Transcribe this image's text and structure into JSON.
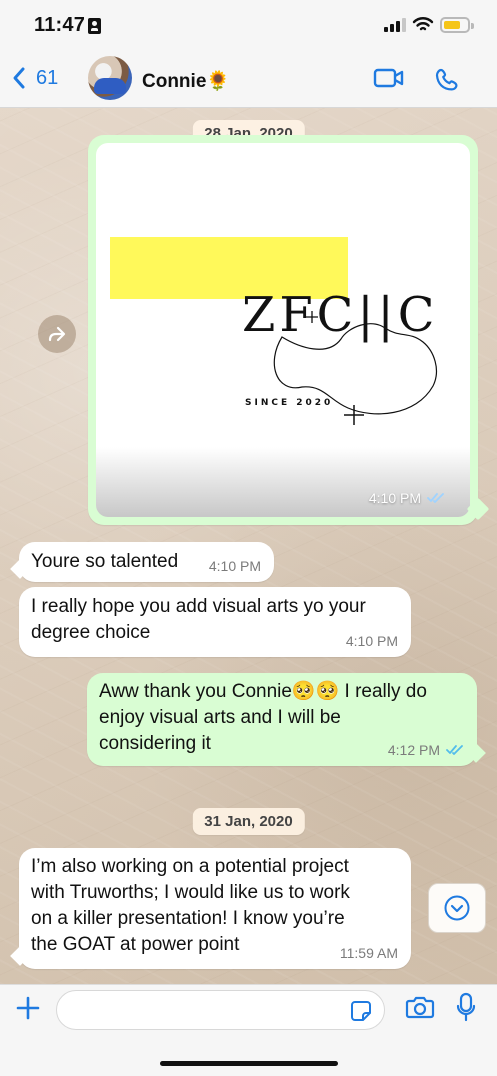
{
  "status_bar": {
    "time": "11:47"
  },
  "header": {
    "back_count": "61",
    "contact_name": "Connie🌻",
    "icons": {
      "back": "chevron-left-icon",
      "video": "video-camera-icon",
      "call": "phone-icon"
    }
  },
  "chat": {
    "date_1": "28 Jan, 2020",
    "image_message": {
      "time": "4:10 PM",
      "logo_text": "ZFC||C",
      "tagline": "SINCE 2020"
    },
    "messages": [
      {
        "direction": "in",
        "text": "Youre so talented",
        "time": "4:10 PM"
      },
      {
        "direction": "in",
        "text": "I really hope you add visual arts yo your\ndegree choice",
        "time": "4:10 PM"
      },
      {
        "direction": "out",
        "text": "Aww thank you Connie🥺🥺 I really do\nenjoy visual arts and I will be\nconsidering it",
        "time": "4:12 PM"
      }
    ],
    "date_2": "31 Jan, 2020",
    "last_message": {
      "direction": "in",
      "text": "I’m also working on a potential project\nwith Truworths; I would like us to work\non a killer presentation! I know you’re\nthe GOAT at power point",
      "time": "11:59 AM"
    }
  },
  "composer": {
    "placeholder": ""
  },
  "colors": {
    "accent": "#1f7ae0",
    "incoming_bubble": "#ffffff",
    "outgoing_bubble": "#d9fdd3",
    "read_receipts": "#53bdeb"
  }
}
